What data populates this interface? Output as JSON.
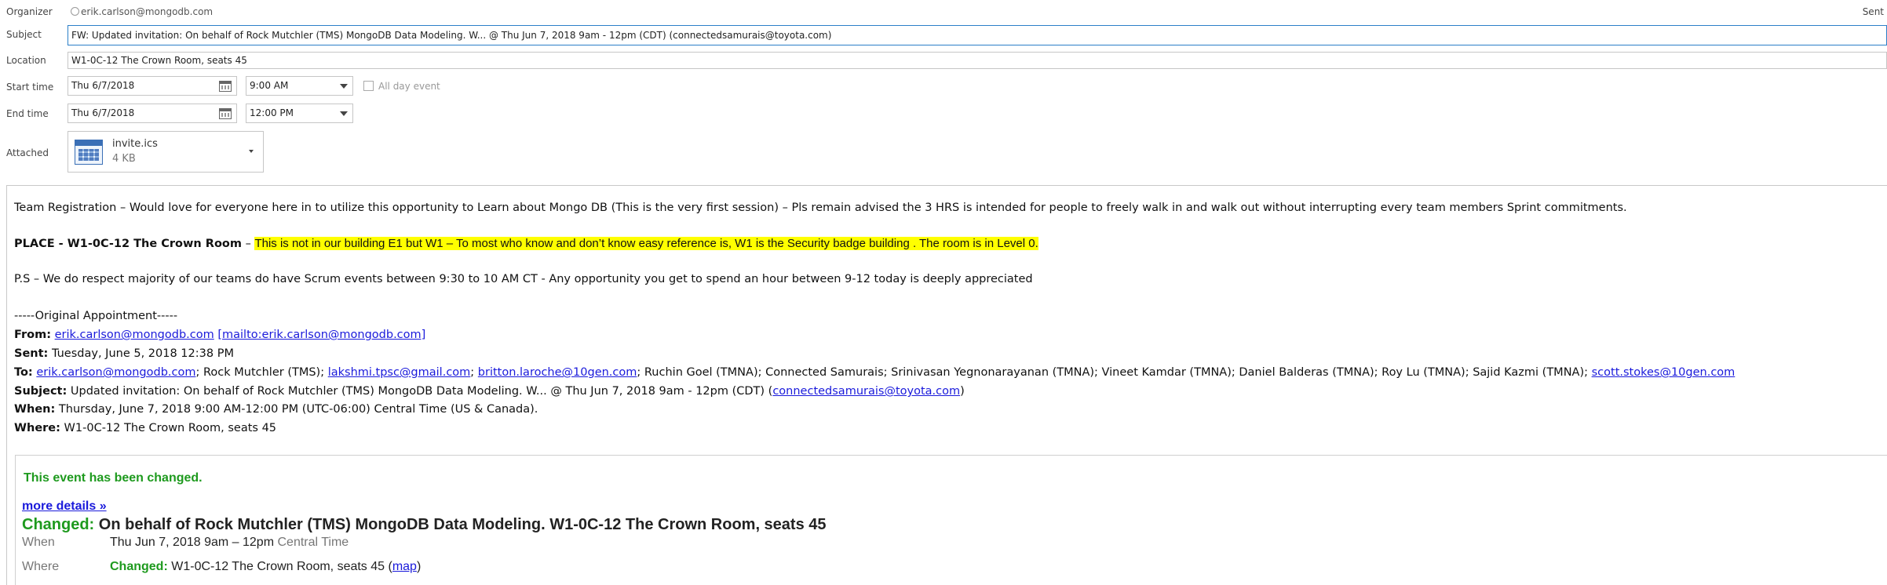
{
  "header": {
    "organizer_label": "Organizer",
    "organizer_value": "erik.carlson@mongodb.com",
    "sent_label": "Sent",
    "subject_label": "Subject",
    "subject_value": "FW: Updated invitation: On behalf of Rock Mutchler (TMS) MongoDB Data Modeling. W... @ Thu Jun 7, 2018 9am - 12pm (CDT) (connectedsamurais@toyota.com)",
    "location_label": "Location",
    "location_value": "W1-0C-12  The Crown Room, seats 45",
    "start_label": "Start time",
    "start_date": "Thu 6/7/2018",
    "start_time": "9:00 AM",
    "all_day_label": "All day event",
    "end_label": "End time",
    "end_date": "Thu 6/7/2018",
    "end_time": "12:00 PM",
    "attached_label": "Attached",
    "attachment_name": "invite.ics",
    "attachment_size": "4 KB"
  },
  "body": {
    "intro": "Team Registration – Would love for everyone here in to utilize this opportunity to Learn about Mongo DB (This is the very first session) – Pls remain advised the 3 HRS is intended for people to freely walk in and walk out without interrupting every team members Sprint commitments.",
    "place_label": "PLACE - W1-0C-12 The Crown Room",
    "place_dash": " – ",
    "place_highlight": "This is not in our building E1 but W1 – To most who know and don’t know easy reference is, W1 is the Security badge building . The room is in Level 0.",
    "ps": "P.S – We do respect majority of our teams do have Scrum events between 9:30 to 10 AM CT - Any opportunity you get to spend an hour between 9-12 today is deeply appreciated",
    "orig_header": "-----Original Appointment-----",
    "from_label": "From:",
    "from_link": "erik.carlson@mongodb.com",
    "from_mailto": "[mailto:erik.carlson@mongodb.com]",
    "sent_label": "Sent:",
    "sent_value": "Tuesday, June 5, 2018 12:38 PM",
    "to_label": "To:",
    "to_link1": "erik.carlson@mongodb.com",
    "to_text1": "; Rock Mutchler (TMS); ",
    "to_link2": "lakshmi.tpsc@gmail.com",
    "to_text2": "; ",
    "to_link3": "britton.laroche@10gen.com",
    "to_text3": "; Ruchin Goel (TMNA); Connected Samurais; Srinivasan Yegnonarayanan (TMNA); Vineet Kamdar (TMNA); Daniel Balderas (TMNA); Roy Lu (TMNA); Sajid Kazmi (TMNA); ",
    "to_link4": "scott.stokes@10gen.com",
    "subject_label": "Subject:",
    "subject_value": "Updated invitation: On behalf of Rock Mutchler (TMS) MongoDB Data Modeling. W... @ Thu Jun 7, 2018 9am - 12pm (CDT) (",
    "subject_link": "connectedsamurais@toyota.com",
    "subject_close": ")",
    "when_label": "When:",
    "when_value": "Thursday, June 7, 2018 9:00 AM-12:00 PM (UTC-06:00) Central Time (US & Canada).",
    "where_label": "Where:",
    "where_value": "W1-0C-12 The Crown Room, seats 45"
  },
  "event": {
    "changed_notice": "This event has been changed.",
    "more_details": "more details »",
    "changed_label": "Changed:",
    "title": "On behalf of Rock Mutchler (TMS) MongoDB Data Modeling. W1-0C-12 The Crown Room, seats 45",
    "when_label": "When",
    "when_value": "Thu Jun 7, 2018 9am – 12pm",
    "when_tz": "Central Time",
    "where_label": "Where",
    "where_changed": "Changed:",
    "where_value": "W1-0C-12 The Crown Room, seats 45 (",
    "map_link": "map",
    "where_close": ")"
  }
}
